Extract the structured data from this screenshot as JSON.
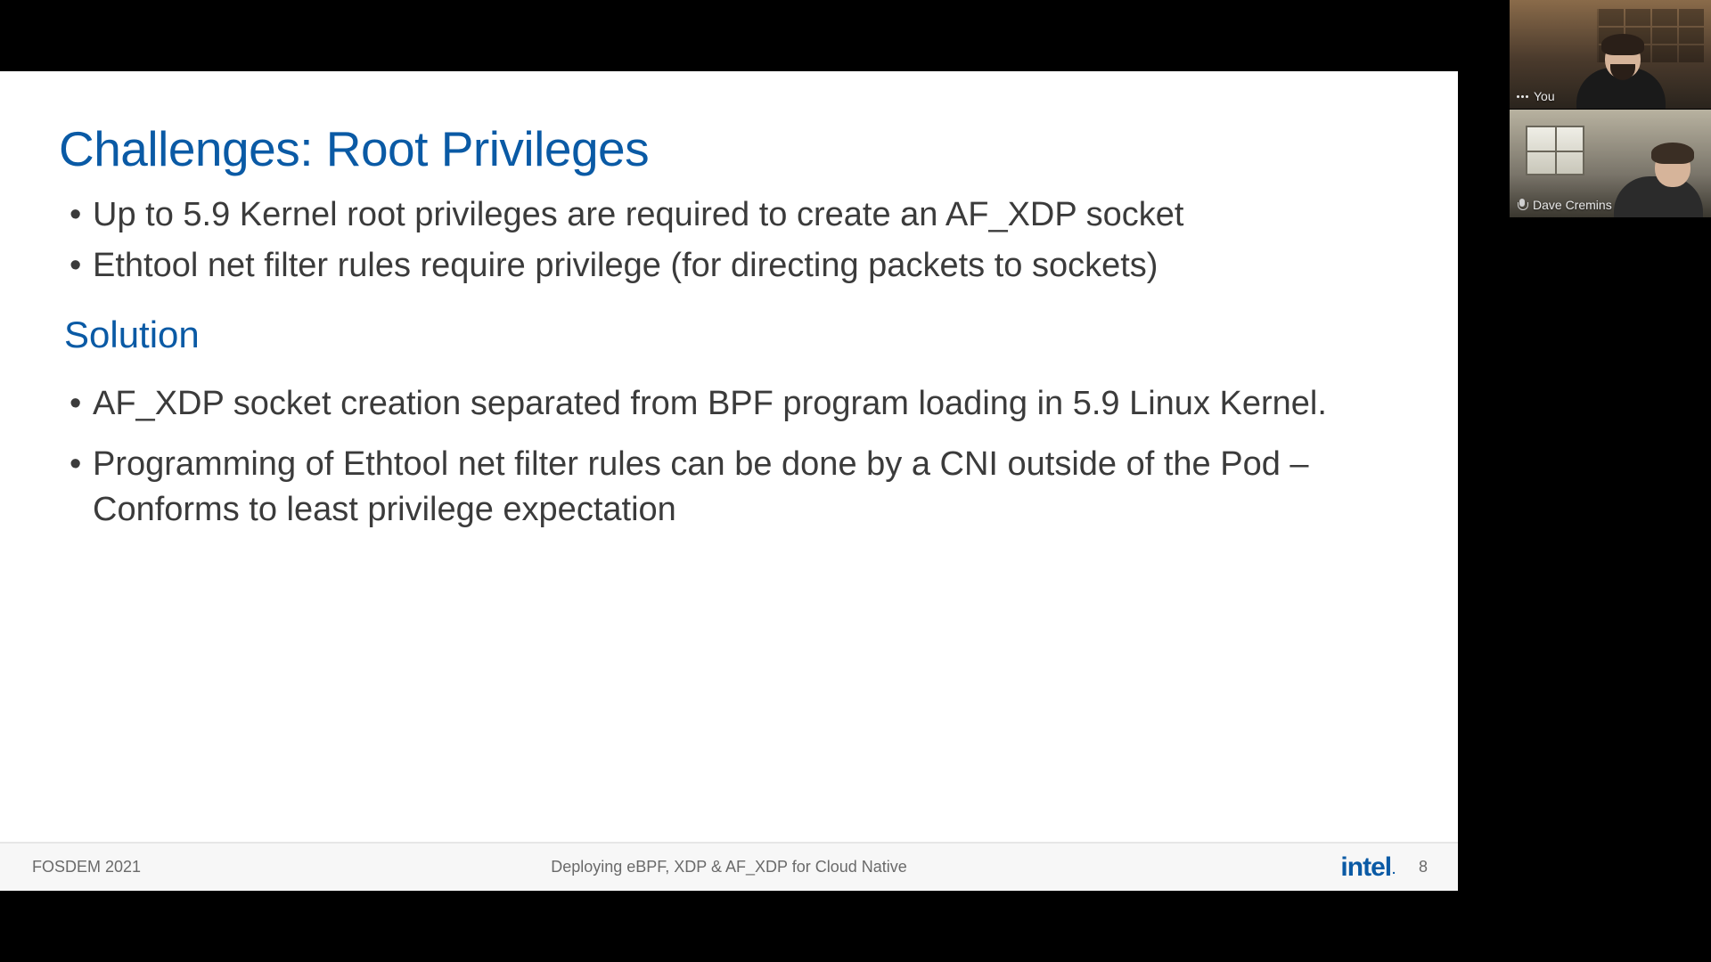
{
  "slide": {
    "title": "Challenges: Root Privileges",
    "bullets": [
      "Up to 5.9 Kernel root privileges are required to create an AF_XDP socket",
      "Ethtool net filter rules require privilege (for directing packets to sockets)"
    ],
    "subheading": "Solution",
    "solution_bullets": [
      "AF_XDP socket creation separated from BPF program loading in 5.9 Linux Kernel.",
      "Programming of Ethtool net filter rules can be done by a CNI outside of the Pod – Conforms to least privilege expectation"
    ]
  },
  "footer": {
    "left": "FOSDEM 2021",
    "center": "Deploying eBPF, XDP & AF_XDP for Cloud Native",
    "logo_text": "intel",
    "page": "8"
  },
  "participants": [
    {
      "label": "You"
    },
    {
      "label": "Dave Cremins"
    }
  ]
}
